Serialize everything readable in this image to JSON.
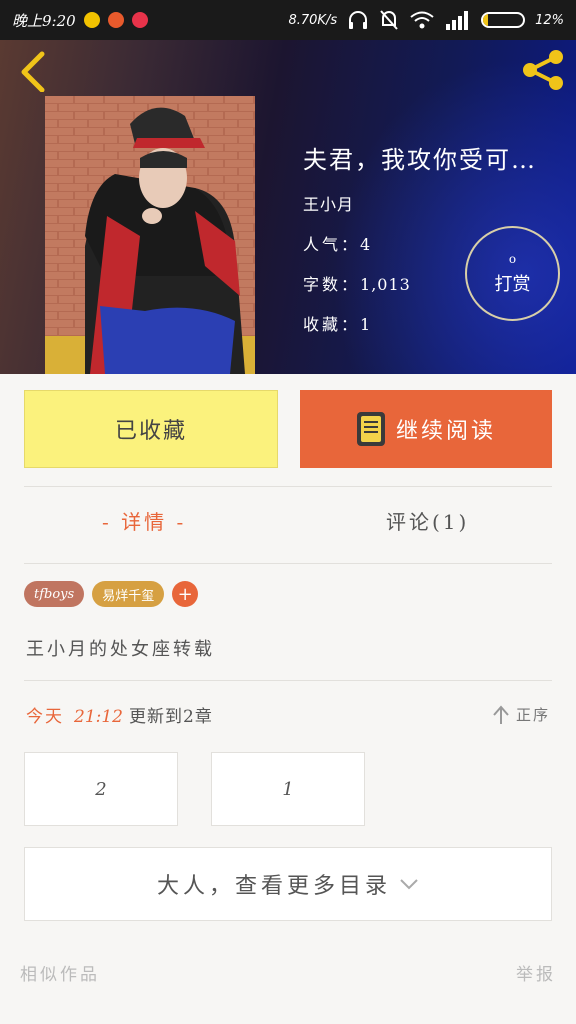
{
  "status_bar": {
    "time": "晚上9:20",
    "net_speed": "8.70K/s",
    "battery": "12%",
    "battery_level": 0.12,
    "icons": [
      "headset-icon",
      "mute-icon",
      "wifi-icon",
      "signal-icon"
    ]
  },
  "header": {
    "back_icon": "chevron-left-icon",
    "share_icon": "share-icon"
  },
  "book": {
    "title": "夫君，我攻你受可…",
    "author": "王小月",
    "popularity_label": "人气：",
    "popularity": "4",
    "words_label": "字数：",
    "words": "1,013",
    "favorites_label": "收藏：",
    "favorites": "1"
  },
  "tip": {
    "coin": "o",
    "label": "打赏"
  },
  "actions": {
    "favorited": "已收藏",
    "continue_reading": "继续阅读"
  },
  "tabs": {
    "detail": "- 详情 -",
    "comments": "评论(1)"
  },
  "tags": [
    "tfboys",
    "易烊千玺"
  ],
  "tag_add": "+",
  "description": "王小月的处女座转载",
  "update": {
    "today": "今天",
    "time": "21:12",
    "text": "更新到2章"
  },
  "sort": {
    "label": "正序"
  },
  "chapters": [
    "2",
    "1"
  ],
  "more_toc": "大人，查看更多目录",
  "footer": {
    "similar": "相似作品",
    "report": "举报"
  },
  "colors": {
    "accent": "#e8663a",
    "fav_yellow": "#fbf27d",
    "tag_brown": "#c07560",
    "tag_gold": "#d6a042"
  }
}
